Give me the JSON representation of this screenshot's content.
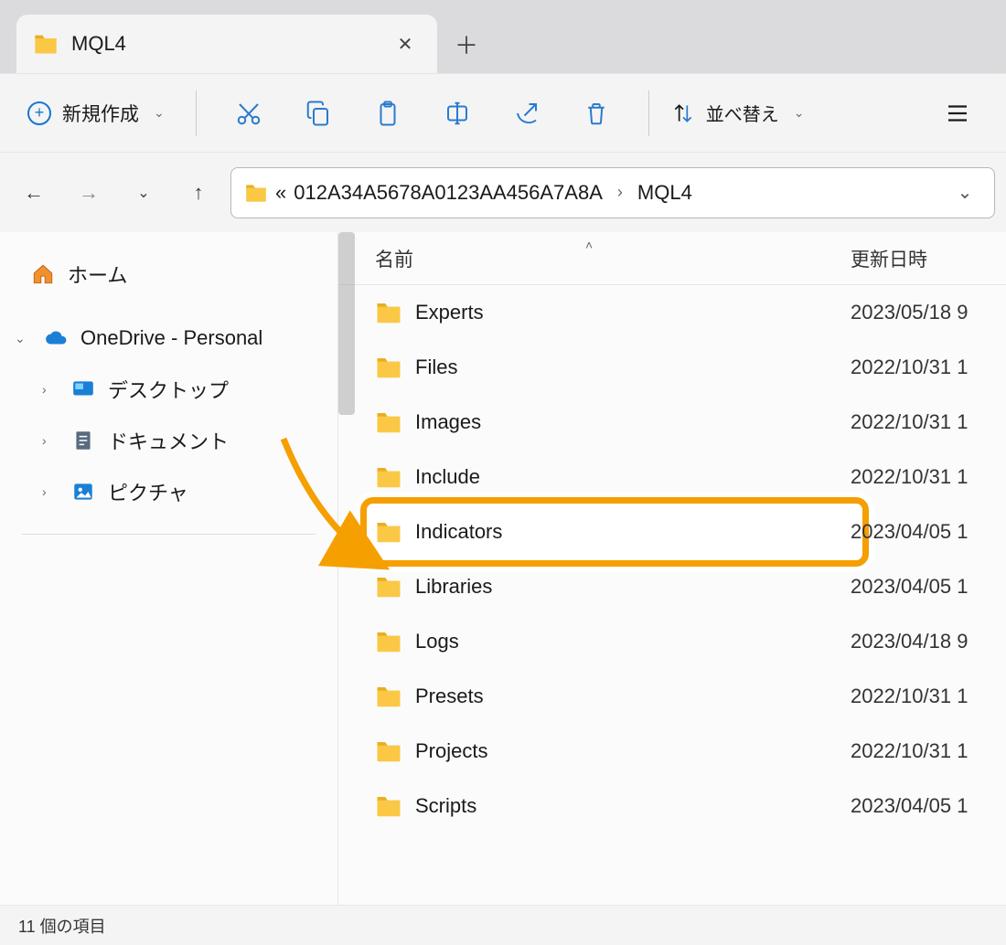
{
  "tab": {
    "title": "MQL4"
  },
  "toolbar": {
    "new_label": "新規作成",
    "sort_label": "並べ替え"
  },
  "address": {
    "overflow": "«",
    "crumb1": "012A34A5678A0123AA456A7A8A",
    "crumb2": "MQL4"
  },
  "sidebar": {
    "home": "ホーム",
    "onedrive": "OneDrive - Personal",
    "desktop": "デスクトップ",
    "documents": "ドキュメント",
    "pictures": "ピクチャ"
  },
  "columns": {
    "name": "名前",
    "date": "更新日時"
  },
  "items": [
    {
      "name": "Experts",
      "date": "2023/05/18 9"
    },
    {
      "name": "Files",
      "date": "2022/10/31 1"
    },
    {
      "name": "Images",
      "date": "2022/10/31 1"
    },
    {
      "name": "Include",
      "date": "2022/10/31 1"
    },
    {
      "name": "Indicators",
      "date": "2023/04/05 1",
      "highlight": true
    },
    {
      "name": "Libraries",
      "date": "2023/04/05 1"
    },
    {
      "name": "Logs",
      "date": "2023/04/18 9"
    },
    {
      "name": "Presets",
      "date": "2022/10/31 1"
    },
    {
      "name": "Projects",
      "date": "2022/10/31 1"
    },
    {
      "name": "Scripts",
      "date": "2023/04/05 1"
    }
  ],
  "status": {
    "count_label": "11 個の項目"
  }
}
